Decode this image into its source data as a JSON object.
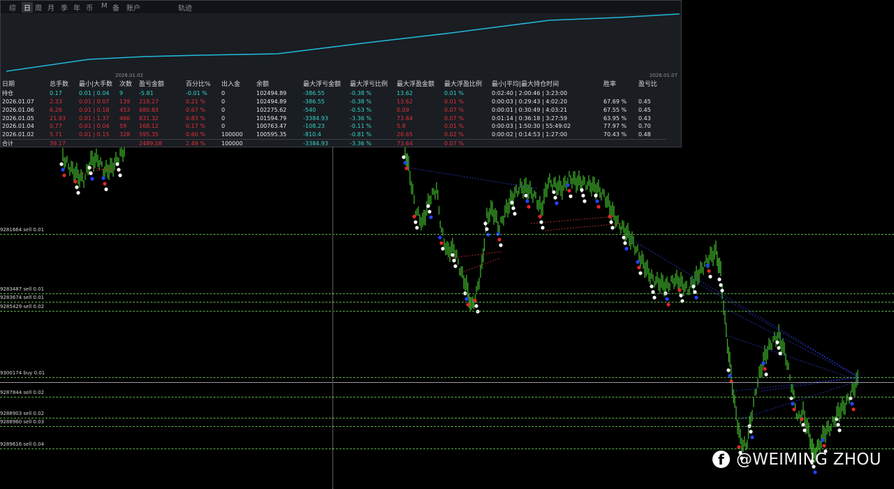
{
  "tabs": [
    "综",
    "日",
    "周",
    "月",
    "季",
    "年",
    "币",
    "M",
    "备",
    "账户",
    "轨迹"
  ],
  "curve_dates": {
    "start": "2026.01.02",
    "end": "2026.01.07"
  },
  "stats": {
    "headers": [
      "日期",
      "总手数",
      "最小|大手数",
      "次数",
      "盈亏金额",
      "百分比%",
      "出入金",
      "余额",
      "最大浮亏金额",
      "最大浮亏比例",
      "最大浮盈金额",
      "最大浮盈比例",
      "最小|平均|最大持仓时间",
      "胜率",
      "盈亏比"
    ],
    "rows": [
      [
        "持仓",
        "0.17",
        "0.01 | 0.04",
        "9",
        "-5.81",
        "-0.01 %",
        "0",
        "102494.89",
        "-386.55",
        "-0.38 %",
        "13.62",
        "0.01 %",
        "0:02:40 | 2:00:46 | 3:23:00",
        "",
        ""
      ],
      [
        "2026.01.07",
        "2.33",
        "0.01 | 0.07",
        "139",
        "219.27",
        "0.21 %",
        "0",
        "102494.89",
        "-386.55",
        "-0.38 %",
        "13.62",
        "0.01 %",
        "0:00:03 | 0:29:43 | 4:02:20",
        "67.69 %",
        "0.45"
      ],
      [
        "2026.01.06",
        "6.26",
        "0.01 | 0.18",
        "453",
        "680.83",
        "0.67 %",
        "0",
        "102275.62",
        "-540",
        "-0.53 %",
        "0.09",
        "0.07 %",
        "0:00:01 | 0:30:49 | 4:03:21",
        "67.55 %",
        "0.45"
      ],
      [
        "2026.01.05",
        "21.93",
        "0.01 | 1.37",
        "466",
        "831.32",
        "0.83 %",
        "0",
        "101594.79",
        "-3384.93",
        "-3.36 %",
        "73.64",
        "0.07 %",
        "0:01:14 | 0:36:18 | 3:27:59",
        "63.95 %",
        "0.43"
      ],
      [
        "2026.01.04",
        "0.77",
        "0.01 | 0.04",
        "59",
        "168.12",
        "0.17 %",
        "0",
        "100763.47",
        "-108.23",
        "-0.11 %",
        "5.8",
        "0.01 %",
        "0:00:03 | 1:50:30 | 55:49:02",
        "77.97 %",
        "0.70"
      ],
      [
        "2026.01.02",
        "5.71",
        "0.01 | 0.15",
        "328",
        "595.35",
        "0.60 %",
        "100000",
        "100595.35",
        "-810.4",
        "-0.81 %",
        "20.65",
        "0.02 %",
        "0:00:02 | 0:14:53 | 1:27:00",
        "70.43 %",
        "0.48"
      ]
    ],
    "total": [
      "合计",
      "39.17",
      "",
      "",
      "2489.08",
      "2.49 %",
      "100000",
      "",
      "-3384.93",
      "-3.36 %",
      "73.64",
      "0.07 %",
      "",
      "",
      ""
    ]
  },
  "order_lines": [
    {
      "label": "9281664 sell 0.01",
      "style": "dashed"
    },
    {
      "label": "9283487 sell 0.01",
      "style": "dashed"
    },
    {
      "label": "9283674 sell 0.01",
      "style": "dashed"
    },
    {
      "label": "9285429 sell 0.02",
      "style": "dashed"
    },
    {
      "label": "9300174 buy 0.01",
      "style": "dashed"
    },
    {
      "label": "",
      "style": "solid"
    },
    {
      "label": "9287844 sell 0.02",
      "style": "dashed"
    },
    {
      "label": "9288903 sell 0.02",
      "style": "dashed"
    },
    {
      "label": "9288960 sell 0.03",
      "style": "dashed"
    },
    {
      "label": "9289616 sell 0.04",
      "style": "dashed"
    }
  ],
  "watermark": "@WEIMING ZHOU",
  "colors": {
    "candle": "#3fae2a",
    "curve": "#22b8d8",
    "cyan_text": "#32d6c8",
    "red_text": "#e0303a",
    "order_line": "#5fb34a"
  }
}
